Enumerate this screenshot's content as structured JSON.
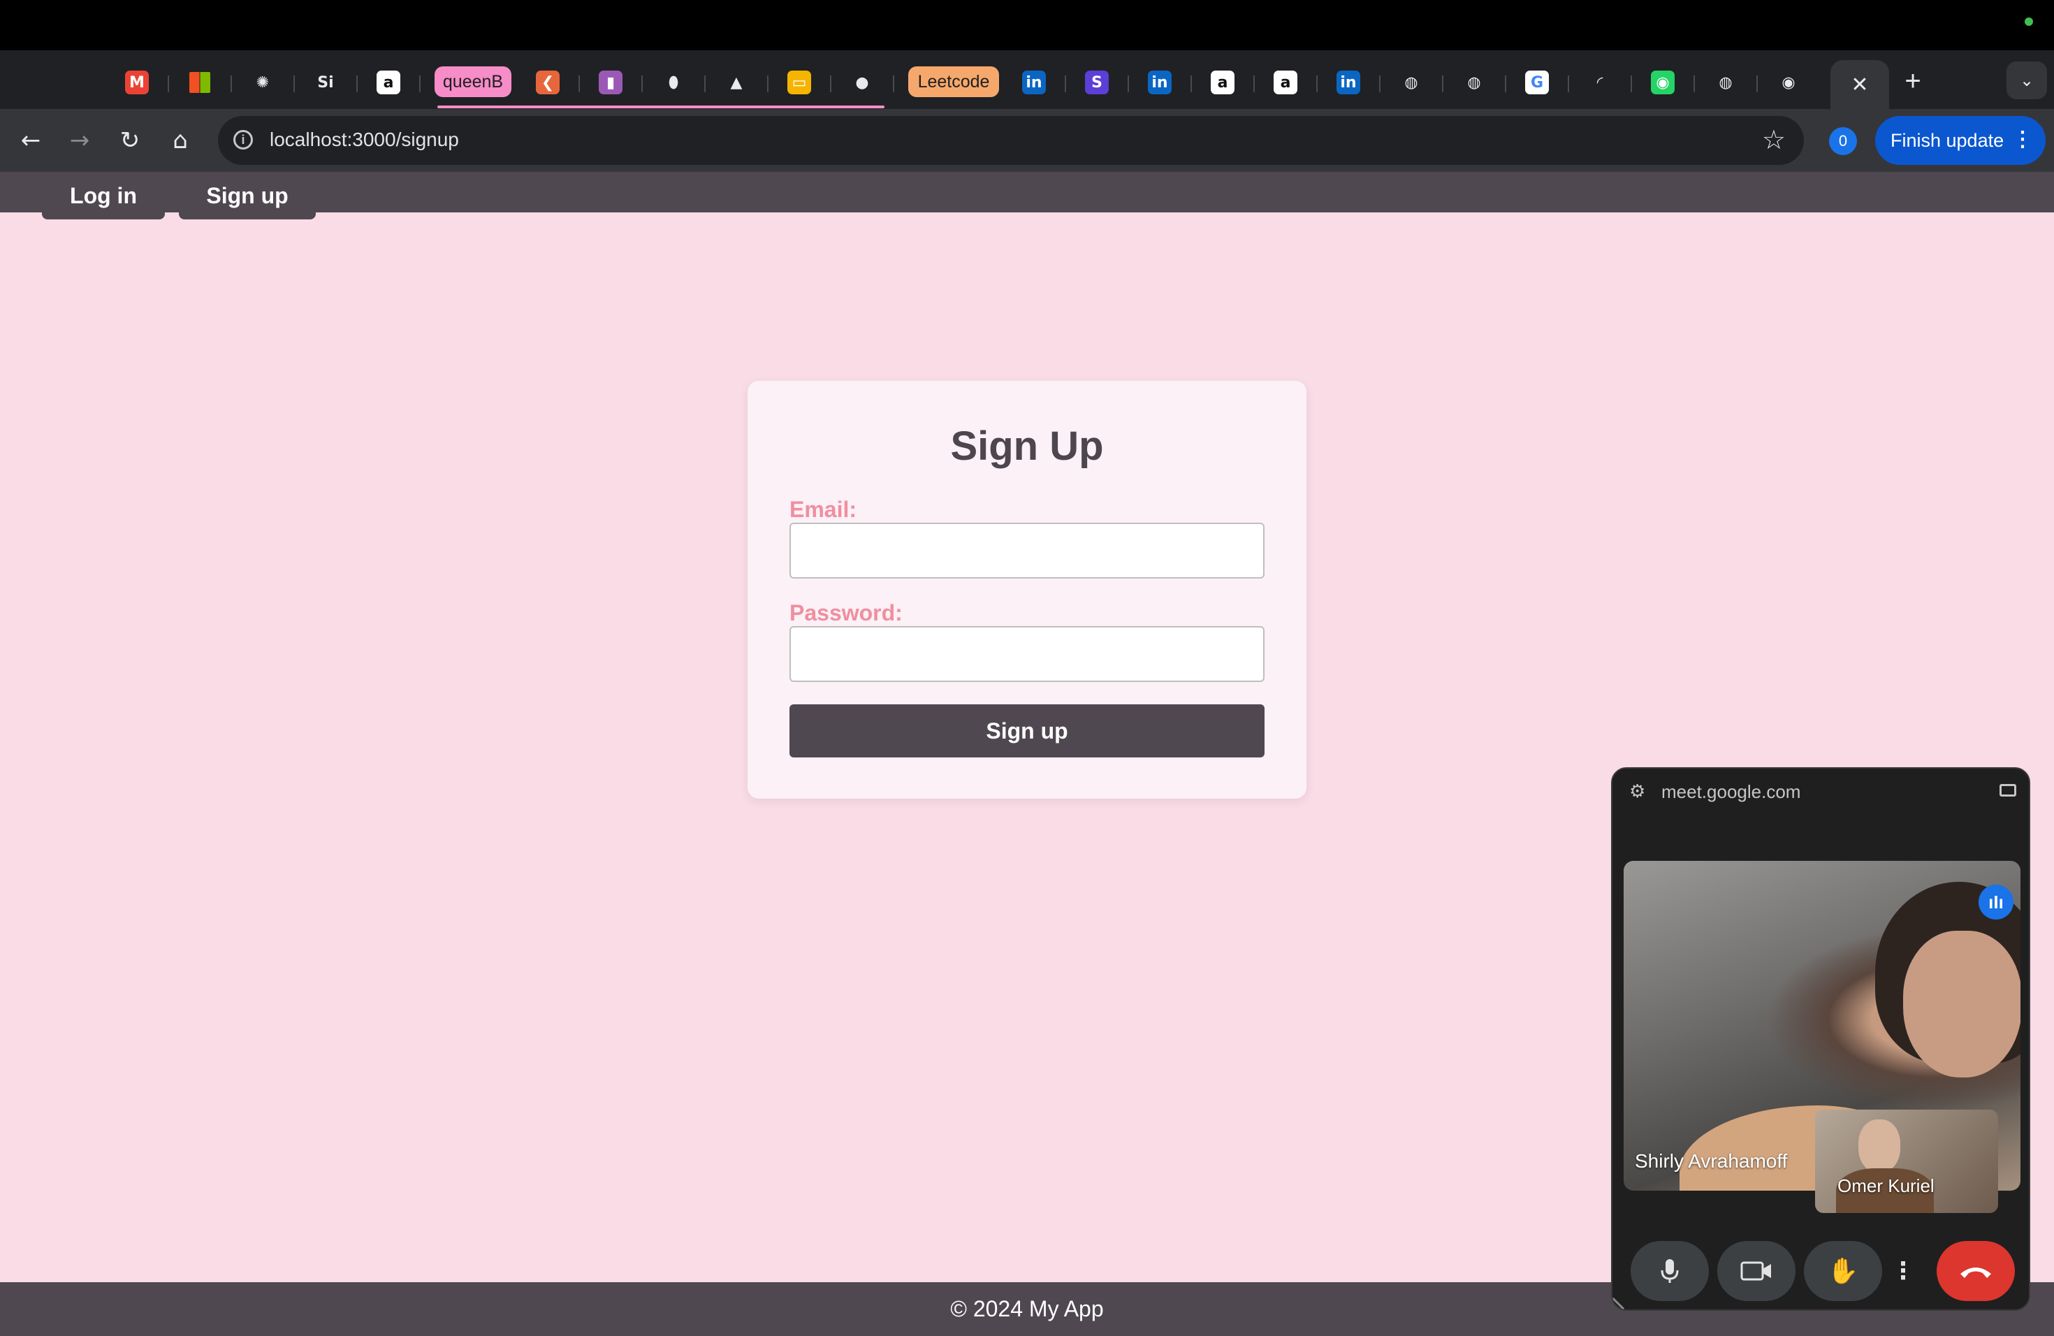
{
  "browser": {
    "tabs": [
      {
        "icon": "gmail-icon",
        "glyph": "M",
        "color": "#ea4335"
      },
      {
        "icon": "microsoft-icon",
        "glyph": "",
        "color": "#f25022"
      },
      {
        "icon": "chatgpt-icon",
        "glyph": "✺",
        "color": "#202124"
      },
      {
        "icon": "si-icon",
        "glyph": "Si",
        "color": "#202124"
      },
      {
        "icon": "amazon-icon",
        "glyph": "a",
        "color": "#ffffff"
      },
      {
        "icon": "orange-app-icon",
        "glyph": "❮",
        "color": "#e8663b"
      },
      {
        "icon": "purple-app-icon",
        "glyph": "▮",
        "color": "#9b59b6"
      },
      {
        "icon": "mongodb-icon",
        "glyph": "⬮",
        "color": "#202124"
      },
      {
        "icon": "google-drive-icon",
        "glyph": "▲",
        "color": "#202124"
      },
      {
        "icon": "google-slides-icon",
        "glyph": "▭",
        "color": "#f4b400"
      },
      {
        "icon": "github-icon",
        "glyph": "●",
        "color": "#202124"
      },
      {
        "icon": "linkedin-icon",
        "glyph": "in",
        "color": "#0a66c2"
      },
      {
        "icon": "stack-icon",
        "glyph": "S",
        "color": "#5b3fd6"
      },
      {
        "icon": "linkedin-icon",
        "glyph": "in",
        "color": "#0a66c2"
      },
      {
        "icon": "amazon-icon",
        "glyph": "a",
        "color": "#ffffff"
      },
      {
        "icon": "amazon-icon",
        "glyph": "a",
        "color": "#ffffff"
      },
      {
        "icon": "linkedin-icon",
        "glyph": "in",
        "color": "#0a66c2"
      },
      {
        "icon": "globe-icon",
        "glyph": "◍",
        "color": "#202124"
      },
      {
        "icon": "globe-icon",
        "glyph": "◍",
        "color": "#202124"
      },
      {
        "icon": "google-icon",
        "glyph": "G",
        "color": "#ffffff"
      },
      {
        "icon": "loading-icon",
        "glyph": "◜",
        "color": "#202124"
      },
      {
        "icon": "whatsapp-icon",
        "glyph": "◉",
        "color": "#25d366"
      },
      {
        "icon": "globe-icon",
        "glyph": "◍",
        "color": "#202124"
      },
      {
        "icon": "record-icon",
        "glyph": "◉",
        "color": "#202124"
      }
    ],
    "group_queenb": {
      "label": "queenB",
      "color": "#f68cc8"
    },
    "group_leetcode": {
      "label": "Leetcode",
      "color": "#f6a86c"
    },
    "active_tab_close": "✕",
    "new_tab": "+",
    "tab_search": "⌄",
    "back": "←",
    "forward": "→",
    "reload": "↻",
    "home": "⌂",
    "info": "i",
    "url": "localhost:3000/signup",
    "bookmark": "☆",
    "profile_badge": "0",
    "finish_update": "Finish update",
    "menu": "⋮"
  },
  "app": {
    "nav": {
      "login": "Log in",
      "signup": "Sign up"
    },
    "form": {
      "title": "Sign Up",
      "email_label": "Email:",
      "email_value": "",
      "password_label": "Password:",
      "password_value": "",
      "submit": "Sign up"
    },
    "footer": "© 2024 My App",
    "colors": {
      "background": "#fadce6",
      "nav": "#504850",
      "label": "#ef8fa0"
    }
  },
  "meet": {
    "host": "meet.google.com",
    "main_participant": "Shirly Avrahamoff",
    "self_participant": "Omer Kuriel",
    "controls": {
      "mic": "🎤",
      "camera": "▶",
      "hand": "✋",
      "more": "⋮",
      "hangup": "☎"
    }
  }
}
